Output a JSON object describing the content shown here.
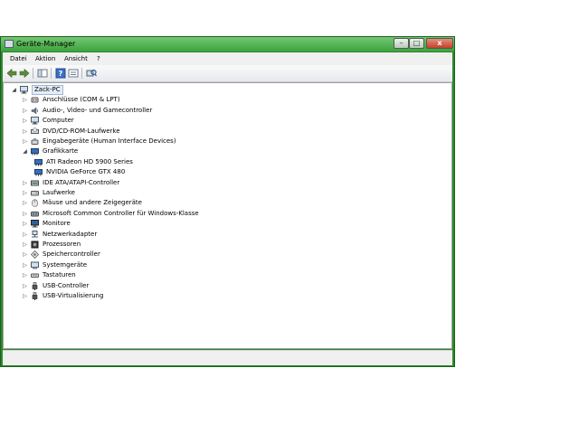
{
  "window": {
    "title": "Geräte-Manager",
    "controls": {
      "minimize": "–",
      "maximize": "□",
      "close": "x"
    }
  },
  "menubar": {
    "items": [
      "Datei",
      "Aktion",
      "Ansicht",
      "?"
    ]
  },
  "toolbar": {
    "icons": [
      "back-arrow-icon",
      "forward-arrow-icon",
      "show-hide-console-tree-icon",
      "help-icon",
      "properties-icon",
      "scan-hardware-changes-icon"
    ]
  },
  "tree": {
    "root": {
      "label": "Zack-PC",
      "icon": "computer-icon",
      "expanded": true
    },
    "items": [
      {
        "label": "Anschlüsse (COM & LPT)",
        "icon": "port-icon",
        "expanded": false
      },
      {
        "label": "Audio-, Video- und Gamecontroller",
        "icon": "speaker-icon",
        "expanded": false
      },
      {
        "label": "Computer",
        "icon": "computer-icon",
        "expanded": false
      },
      {
        "label": "DVD/CD-ROM-Laufwerke",
        "icon": "disc-drive-icon",
        "expanded": false
      },
      {
        "label": "Eingabegeräte (Human Interface Devices)",
        "icon": "hid-icon",
        "expanded": false
      },
      {
        "label": "Grafikkarte",
        "icon": "display-adapter-icon",
        "expanded": true,
        "children": [
          {
            "label": "ATI Radeon HD 5900 Series",
            "icon": "display-adapter-icon"
          },
          {
            "label": "NVIDIA GeForce GTX 480",
            "icon": "display-adapter-icon"
          }
        ]
      },
      {
        "label": "IDE ATA/ATAPI-Controller",
        "icon": "ide-controller-icon",
        "expanded": false
      },
      {
        "label": "Laufwerke",
        "icon": "disk-drive-icon",
        "expanded": false
      },
      {
        "label": "Mäuse und andere Zeigegeräte",
        "icon": "mouse-icon",
        "expanded": false
      },
      {
        "label": "Microsoft Common Controller für Windows-Klasse",
        "icon": "controller-icon",
        "expanded": false
      },
      {
        "label": "Monitore",
        "icon": "monitor-icon",
        "expanded": false
      },
      {
        "label": "Netzwerkadapter",
        "icon": "network-adapter-icon",
        "expanded": false
      },
      {
        "label": "Prozessoren",
        "icon": "processor-icon",
        "expanded": false
      },
      {
        "label": "Speichercontroller",
        "icon": "storage-controller-icon",
        "expanded": false
      },
      {
        "label": "Systemgeräte",
        "icon": "system-device-icon",
        "expanded": false
      },
      {
        "label": "Tastaturen",
        "icon": "keyboard-icon",
        "expanded": false
      },
      {
        "label": "USB-Controller",
        "icon": "usb-icon",
        "expanded": false
      },
      {
        "label": "USB-Virtualisierung",
        "icon": "usb-icon",
        "expanded": false
      }
    ]
  },
  "colors": {
    "frame": "#2c8a2c",
    "titlebar_top": "#73c873",
    "titlebar_bottom": "#3da23d",
    "menubar": "#f0f0f0",
    "tree_background": "#ffffff",
    "root_highlight": "#e4ecf7"
  }
}
